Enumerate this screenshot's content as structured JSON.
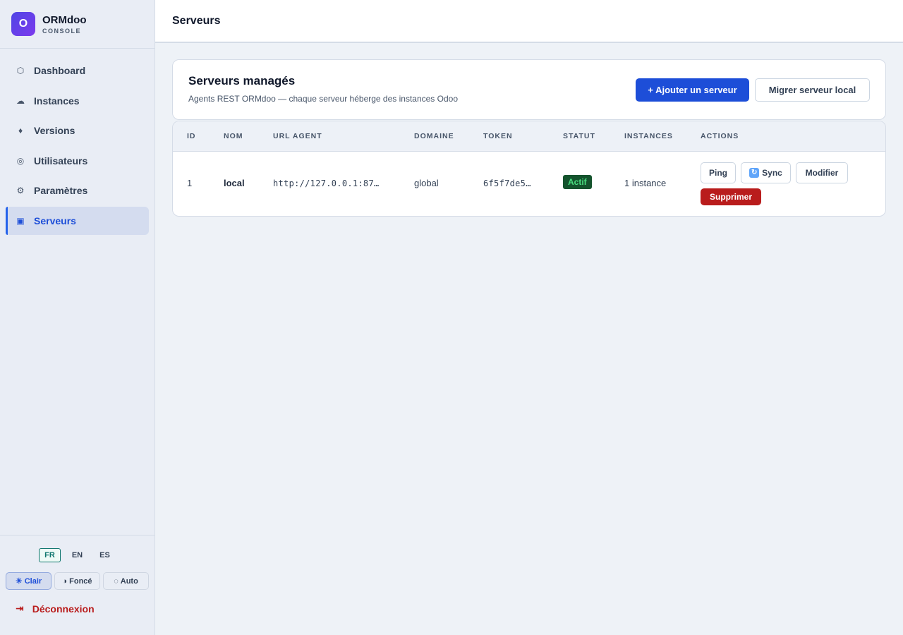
{
  "brand": {
    "logo_letter": "O",
    "name": "ORMdoo",
    "subtitle": "CONSOLE"
  },
  "nav": [
    {
      "label": "Dashboard",
      "icon": "hexagon-icon",
      "glyph": "⬡",
      "active": false
    },
    {
      "label": "Instances",
      "icon": "cloud-icon",
      "glyph": "☁",
      "active": false
    },
    {
      "label": "Versions",
      "icon": "diamond-icon",
      "glyph": "♦",
      "active": false
    },
    {
      "label": "Utilisateurs",
      "icon": "users-icon",
      "glyph": "◎",
      "active": false
    },
    {
      "label": "Paramètres",
      "icon": "gear-icon",
      "glyph": "⚙",
      "active": false
    },
    {
      "label": "Serveurs",
      "icon": "server-icon",
      "glyph": "▣",
      "active": true
    }
  ],
  "languages": {
    "items": [
      "FR",
      "EN",
      "ES"
    ],
    "active": "FR"
  },
  "themes": [
    {
      "label": "Clair",
      "glyph": "☀",
      "active": true
    },
    {
      "label": "Foncé",
      "glyph": "◑",
      "active": false
    },
    {
      "label": "Auto",
      "glyph": "◌",
      "active": false
    }
  ],
  "logout": {
    "label": "Déconnexion",
    "glyph": "⇥"
  },
  "page": {
    "title": "Serveurs"
  },
  "header_card": {
    "title": "Serveurs managés",
    "subtitle": "Agents REST ORMdoo — chaque serveur héberge des instances Odoo",
    "add_button": "+ Ajouter un serveur",
    "migrate_button": "Migrer serveur local"
  },
  "table": {
    "columns": [
      "ID",
      "NOM",
      "URL AGENT",
      "DOMAINE",
      "TOKEN",
      "STATUT",
      "INSTANCES",
      "ACTIONS"
    ],
    "rows": [
      {
        "id": "1",
        "name": "local",
        "url": "http://127.0.0.1:87…",
        "domain": "global",
        "token": "6f5f7de5…",
        "status": "Actif",
        "instances": "1 instance",
        "actions": {
          "ping": "Ping",
          "sync": "Sync",
          "edit": "Modifier",
          "delete": "Supprimer"
        }
      }
    ]
  },
  "colors": {
    "accent": "#1d4ed8",
    "danger": "#b91c1c",
    "success_bg": "#14532d",
    "success_text": "#4ade80"
  }
}
